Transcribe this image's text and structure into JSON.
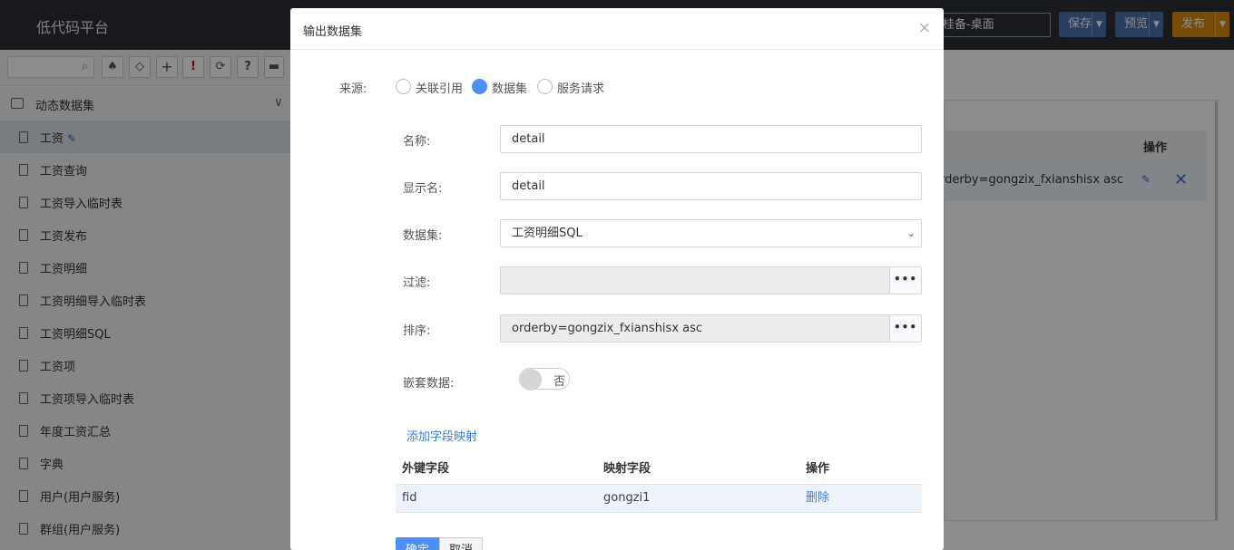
{
  "app": {
    "title": "低代码平台"
  },
  "topbar": {
    "env_select": "桂备-桌面",
    "save_label": "保存",
    "preview_label": "预览",
    "publish_label": "发布",
    "dropdown_glyph": "▼",
    "colors": {
      "save": "#4a6fb0",
      "preview": "#4a6fb0",
      "publish": "#d98b12"
    }
  },
  "toolbar": {
    "icons": [
      "search-icon",
      "tree-icon",
      "tag-icon",
      "plus-icon",
      "exclamation-icon",
      "refresh-icon",
      "help-icon",
      "more-icon"
    ],
    "glyphs": {
      "plus": "+",
      "exclamation": "!",
      "refresh": "⟳",
      "help": "?",
      "search": "⌕",
      "tree": "♠",
      "tag": "◇",
      "more": "▬"
    }
  },
  "sidebar": {
    "group_title": "动态数据集",
    "items": [
      {
        "label": "工资",
        "active": true
      },
      {
        "label": "工资查询"
      },
      {
        "label": "工资导入临时表"
      },
      {
        "label": "工资发布"
      },
      {
        "label": "工资明细"
      },
      {
        "label": "工资明细导入临时表"
      },
      {
        "label": "工资明细SQL"
      },
      {
        "label": "工资项"
      },
      {
        "label": "工资项导入临时表"
      },
      {
        "label": "年度工资汇总"
      },
      {
        "label": "字典"
      },
      {
        "label": "用户(用户服务)"
      },
      {
        "label": "群组(用户服务)"
      }
    ]
  },
  "background_table": {
    "op_header": "操作",
    "row_text": "orderby=gongzix_fxianshisx asc"
  },
  "modal": {
    "title": "输出数据集",
    "close_glyph": "×",
    "source_label": "来源:",
    "source_options": [
      {
        "label": "关联引用",
        "checked": false
      },
      {
        "label": "数据集",
        "checked": true
      },
      {
        "label": "服务请求",
        "checked": false
      }
    ],
    "fields": {
      "name_label": "名称:",
      "name_value": "detail",
      "display_label": "显示名:",
      "display_value": "detail",
      "dataset_label": "数据集:",
      "dataset_value": "工资明细SQL",
      "filter_label": "过滤:",
      "filter_value": "",
      "sort_label": "排序:",
      "sort_value": "orderby=gongzix_fxianshisx asc",
      "dots_glyph": "•••",
      "nested_label": "嵌套数据:",
      "nested_value": "否"
    },
    "add_mapping_label": "添加字段映射",
    "mapping_table": {
      "headers": [
        "外键字段",
        "映射字段",
        "操作"
      ],
      "rows": [
        {
          "fk": "fid",
          "mapped": "gongzi1",
          "action": "删除"
        }
      ]
    },
    "ok_label": "确定",
    "cancel_label": "取消"
  }
}
